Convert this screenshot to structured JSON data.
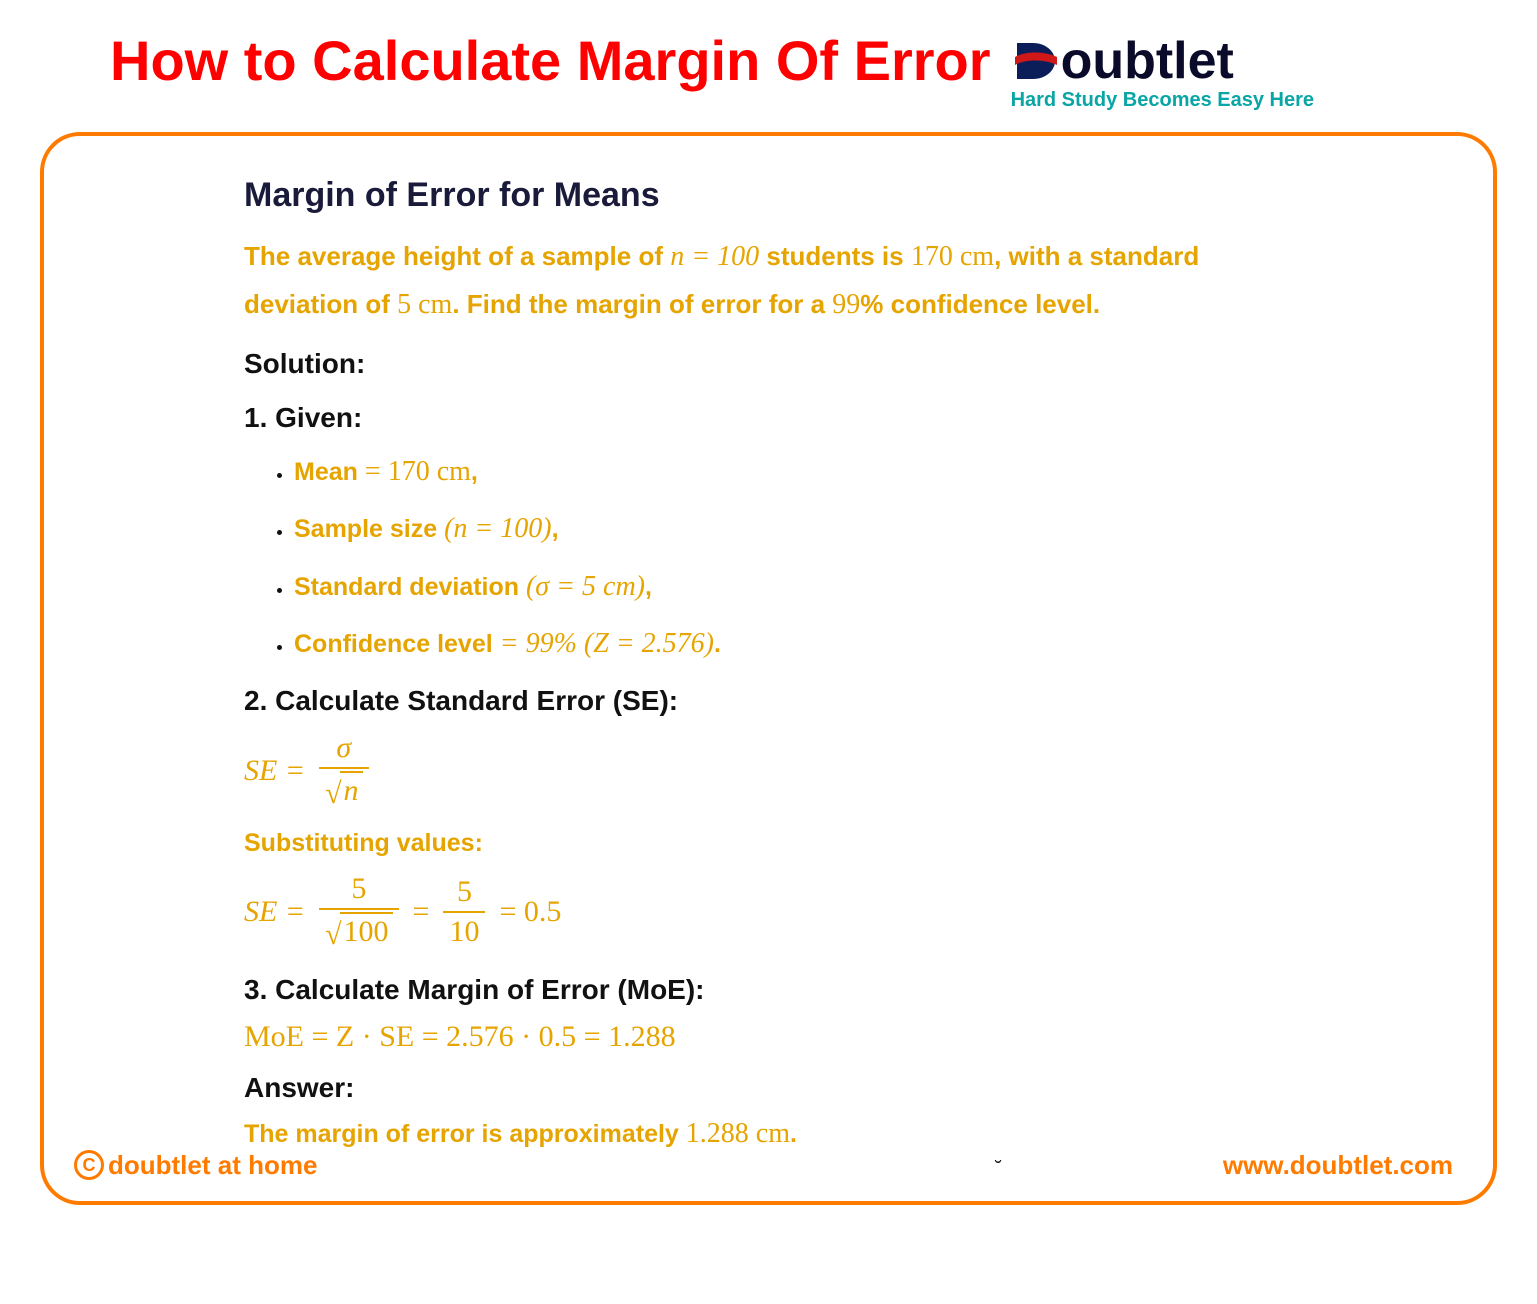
{
  "header": {
    "title": "How to Calculate Margin Of Error",
    "brand_rest": "oubtlet",
    "tagline": "Hard Study Becomes Easy Here"
  },
  "card": {
    "section_title": "Margin of Error for Means",
    "problem_p1a": "The average height of a sample of ",
    "problem_n_eq": "n = 100",
    "problem_p1b": " students is ",
    "problem_height": "170 cm",
    "problem_p1c": ", with a standard",
    "problem_p2a": "deviation of ",
    "problem_sd": "5 cm",
    "problem_p2b": ". Find the margin of error for a ",
    "problem_conf": "99",
    "problem_p2c": "% confidence level.",
    "solution_label": "Solution:",
    "step1_label": "1. Given:",
    "given": {
      "mean_label": "Mean",
      "mean_val": " = 170 cm",
      "size_label": "Sample size ",
      "size_val": "(n = 100)",
      "sd_label": "Standard deviation ",
      "sd_val": "(σ = 5 cm)",
      "conf_label": "Confidence level",
      "conf_val": " = 99% (Z = 2.576)"
    },
    "step2_label": "2. Calculate Standard Error (SE):",
    "se_lhs": "SE =",
    "se_sigma": "σ",
    "se_rootn": "n",
    "sub_label": "Substituting values:",
    "se2_num": "5",
    "se2_den": "100",
    "se2_mid_num": "5",
    "se2_mid_den": "10",
    "se2_result": "= 0.5",
    "step3_label": "3. Calculate Margin of Error (MoE):",
    "moe_line": "MoE = Z · SE = 2.576 · 0.5 = 1.288",
    "answer_label": "Answer:",
    "answer_text_a": "The margin of error is approximately ",
    "answer_val": "1.288 cm",
    "answer_text_b": "."
  },
  "footer": {
    "left": "doubtlet at home",
    "right": "www.doubtlet.com"
  }
}
